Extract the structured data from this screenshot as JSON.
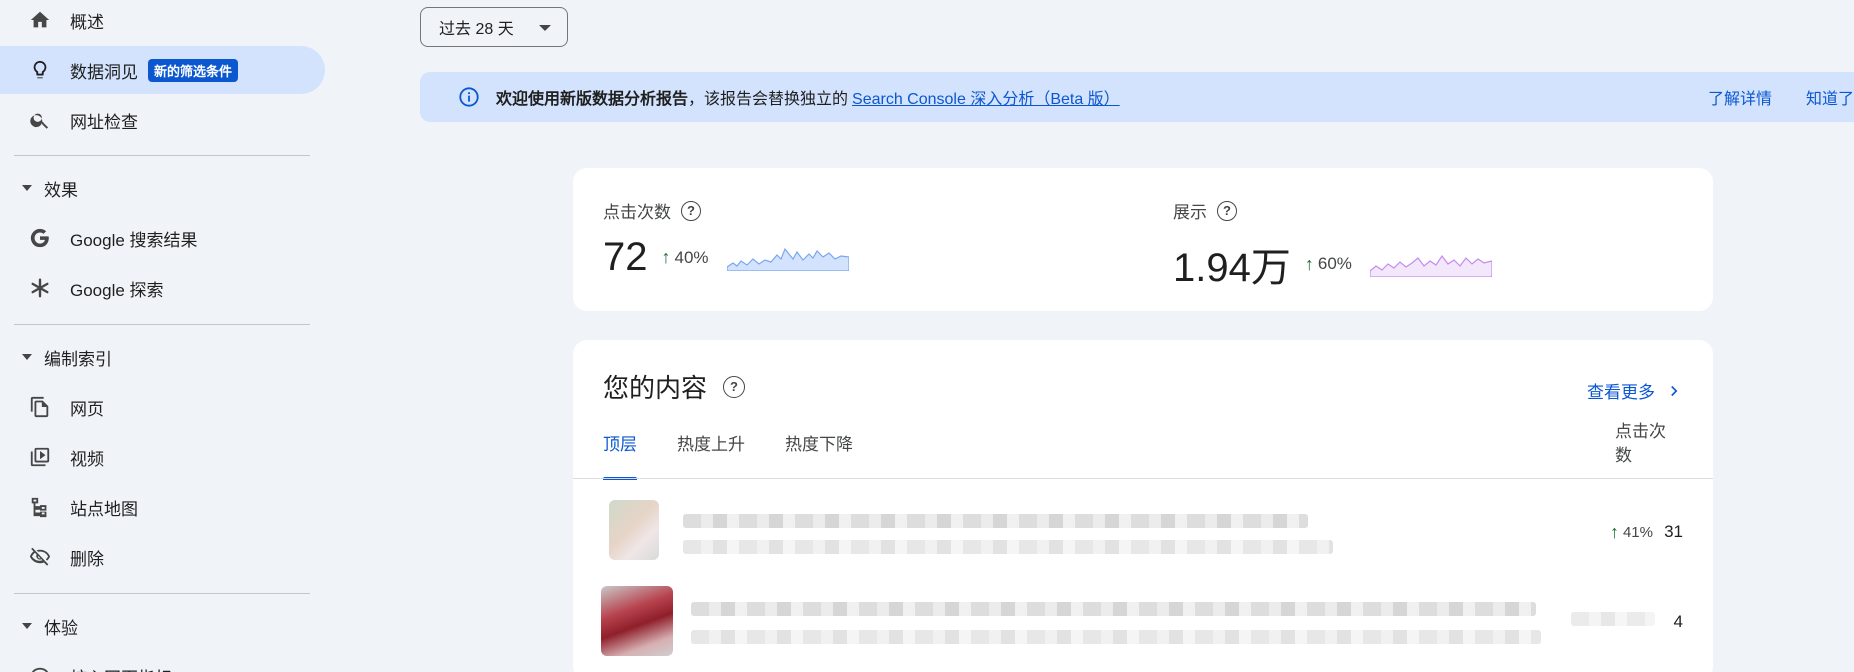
{
  "sidebar": {
    "overview": "概述",
    "insights": "数据洞见",
    "insights_badge": "新的筛选条件",
    "url_inspection": "网址检查",
    "section_performance": "效果",
    "google_search": "Google 搜索结果",
    "google_discover": "Google 探索",
    "section_indexing": "编制索引",
    "pages": "网页",
    "videos": "视频",
    "sitemaps": "站点地图",
    "removals": "删除",
    "section_experience": "体验",
    "page_experience_partial": "核心网页指标"
  },
  "date_range": {
    "label": "过去 28 天"
  },
  "banner": {
    "bold_text": "欢迎使用新版数据分析报告",
    "text": "，该报告会替换独立的",
    "link_text": "Search Console 深入分析（Beta 版）",
    "learn_more": "了解详情",
    "dismiss": "知道了"
  },
  "metrics": {
    "clicks": {
      "label": "点击次数",
      "value": "72",
      "change": "40%"
    },
    "impressions": {
      "label": "展示",
      "value": "1.94万",
      "change": "60%"
    }
  },
  "content": {
    "title": "您的内容",
    "see_more": "查看更多",
    "tabs": [
      "顶层",
      "热度上升",
      "热度下降"
    ],
    "column_header": "点击次数",
    "rows": [
      {
        "change": "41%",
        "value": "31"
      },
      {
        "change": "",
        "value": "4"
      }
    ]
  },
  "colors": {
    "accent": "#0b57d0",
    "active_bg": "#d3e3fd",
    "up": "#146c2e"
  }
}
